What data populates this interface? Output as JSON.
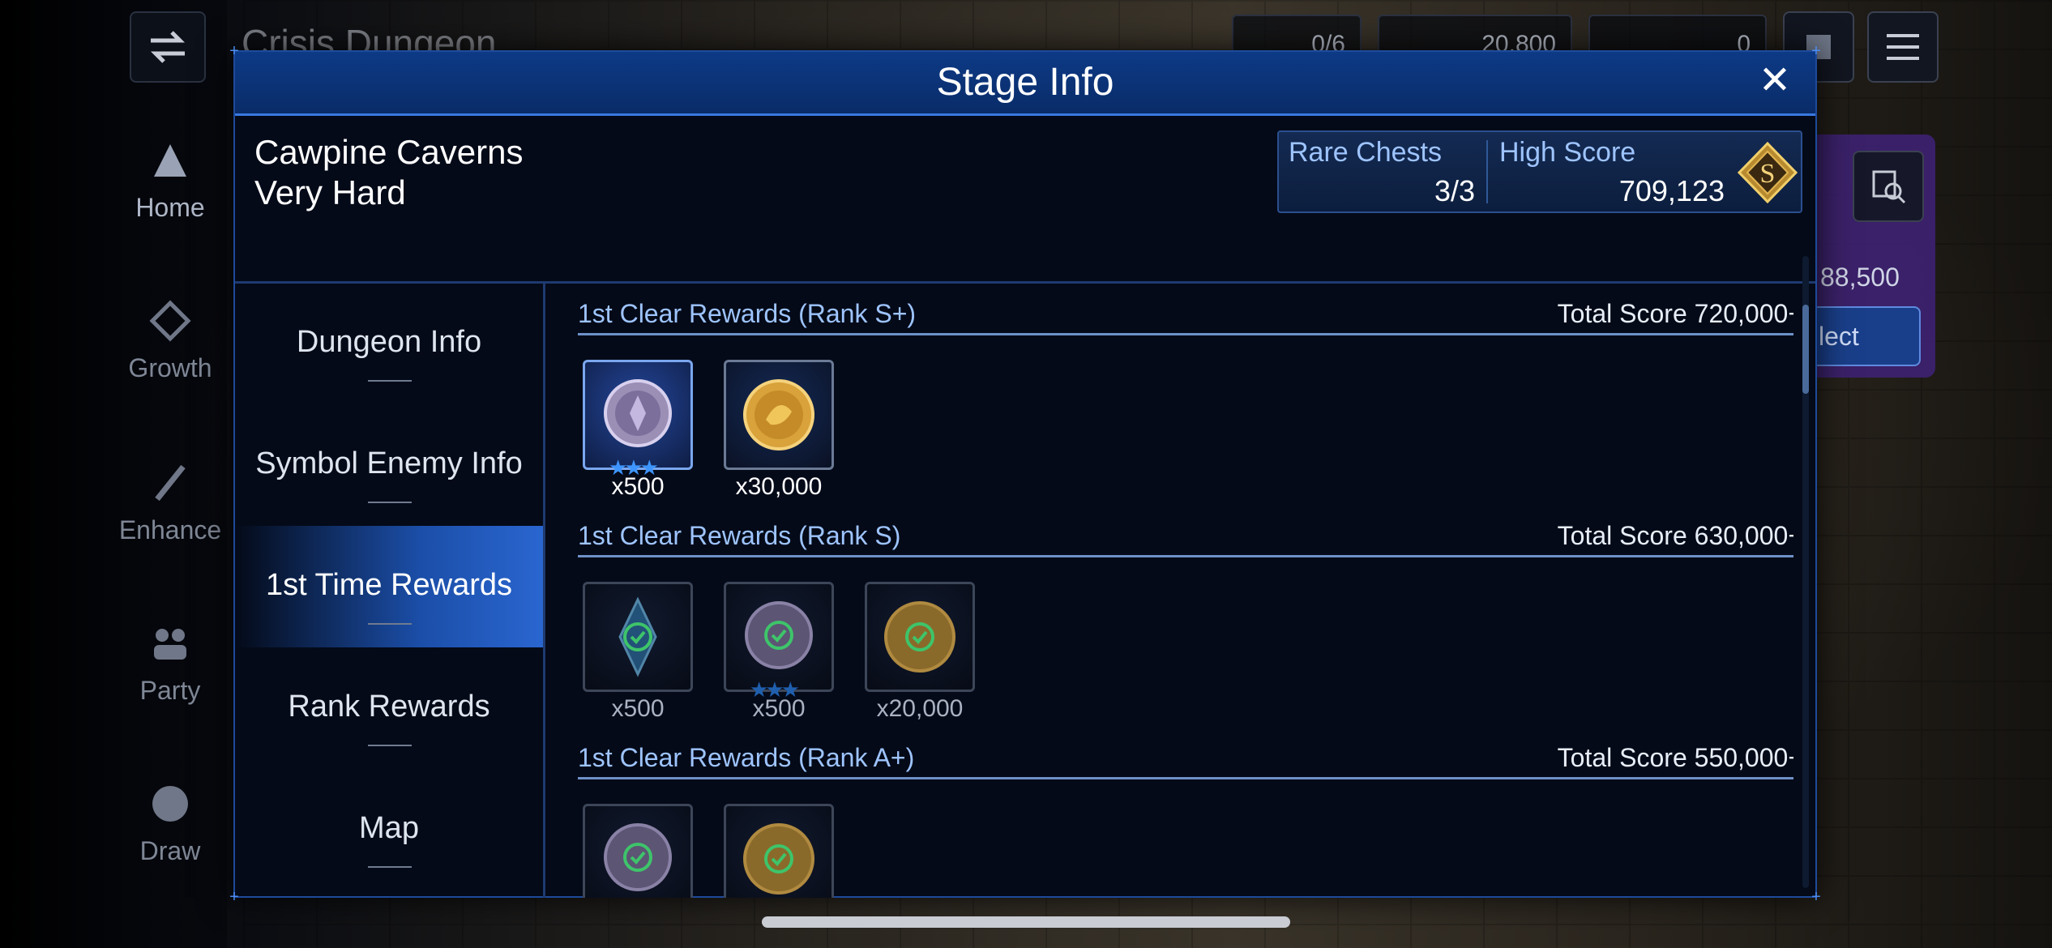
{
  "background": {
    "top_title": "Crisis Dungeon",
    "nav": [
      {
        "label": "Home",
        "icon": "home-icon"
      },
      {
        "label": "Growth",
        "icon": "growth-icon"
      },
      {
        "label": "Enhance",
        "icon": "enhance-icon"
      },
      {
        "label": "Party",
        "icon": "party-icon"
      },
      {
        "label": "Draw",
        "icon": "draw-icon"
      }
    ],
    "resources": {
      "stamina": "0/6",
      "crystals": "20,800",
      "gems": "0"
    },
    "side_score": "88,500",
    "side_select": "lect"
  },
  "modal": {
    "title": "Stage Info",
    "close_glyph": "✕",
    "stage_name": "Cawpine Caverns",
    "difficulty": "Very Hard",
    "rare_chests_label": "Rare Chests",
    "rare_chests_value": "3/3",
    "high_score_label": "High Score",
    "high_score_value": "709,123",
    "rank_letter": "S"
  },
  "tabs": [
    {
      "label": "Dungeon Info",
      "active": false
    },
    {
      "label": "Symbol Enemy Info",
      "active": false
    },
    {
      "label": "1st Time Rewards",
      "active": true
    },
    {
      "label": "Rank Rewards",
      "active": false
    },
    {
      "label": "Map",
      "active": false
    }
  ],
  "sections": [
    {
      "title": "1st Clear Rewards (Rank S+)",
      "score": "Total Score 720,000+",
      "items": [
        {
          "icon": "silver-medal-icon",
          "qty": "x500",
          "stars": "★★★",
          "claimed": false
        },
        {
          "icon": "gold-coin-icon",
          "qty": "x30,000",
          "stars": "",
          "claimed": false
        }
      ]
    },
    {
      "title": "1st Clear Rewards (Rank S)",
      "score": "Total Score 630,000+",
      "items": [
        {
          "icon": "crystal-icon",
          "qty": "x500",
          "stars": "",
          "claimed": true
        },
        {
          "icon": "silver-medal-icon",
          "qty": "x500",
          "stars": "★★★",
          "claimed": true
        },
        {
          "icon": "gold-coin-icon",
          "qty": "x20,000",
          "stars": "",
          "claimed": true
        }
      ]
    },
    {
      "title": "1st Clear Rewards (Rank A+)",
      "score": "Total Score 550,000+",
      "items": [
        {
          "icon": "silver-medal-icon",
          "qty": "",
          "stars": "★★★",
          "claimed": true
        },
        {
          "icon": "gold-coin-icon",
          "qty": "",
          "stars": "",
          "claimed": true
        }
      ]
    }
  ]
}
